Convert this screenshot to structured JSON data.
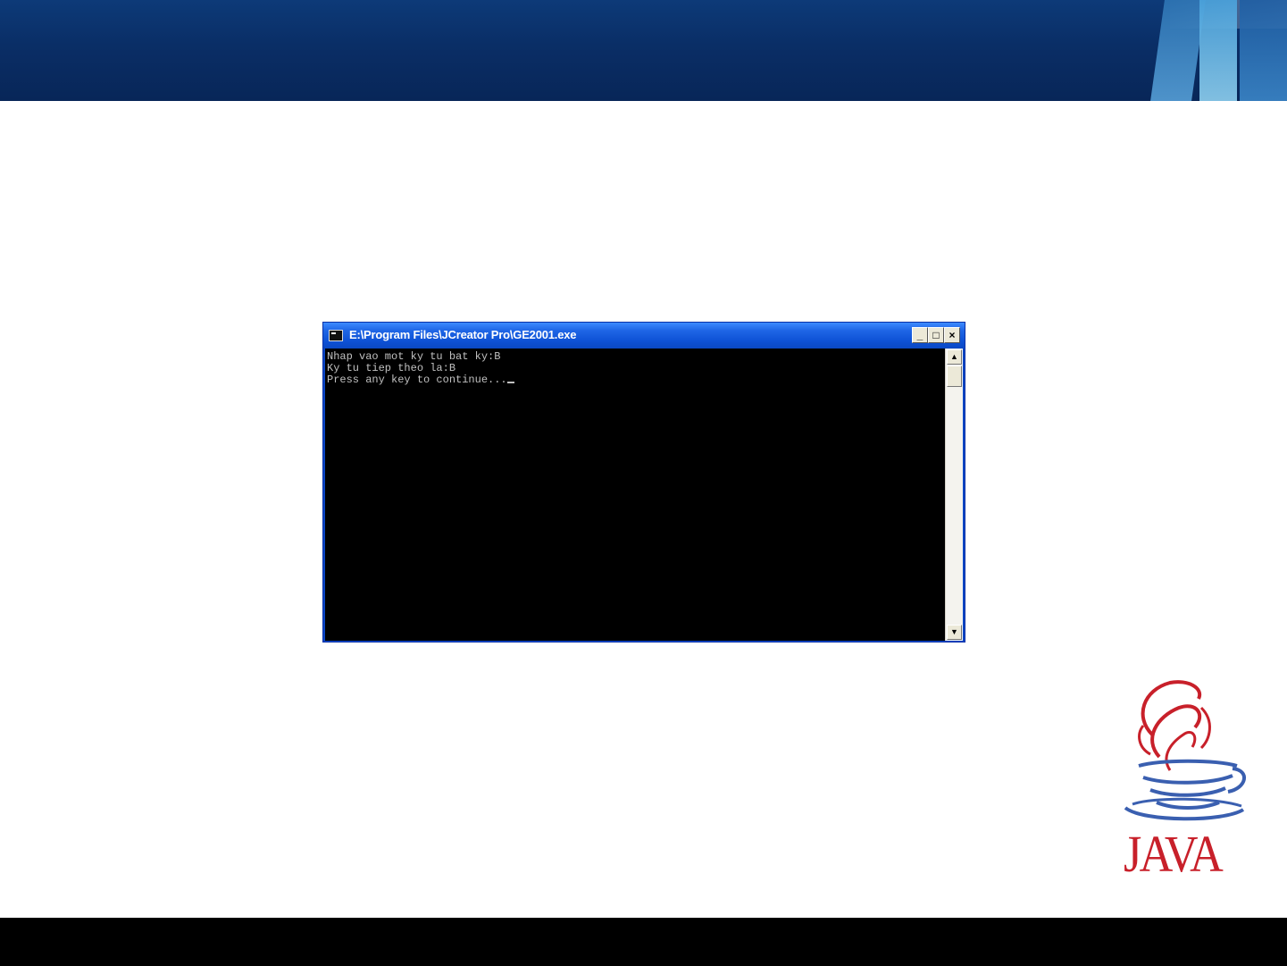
{
  "colors": {
    "header_background": "#0a2e66",
    "titlebar_blue": "#0e52d6",
    "console_background": "#000000",
    "console_text": "#c0c0c0",
    "java_red": "#c8202a",
    "java_blue": "#3a5fb0",
    "footer_background": "#000000"
  },
  "console_window": {
    "title": "E:\\Program Files\\JCreator Pro\\GE2001.exe",
    "buttons": {
      "minimize": "_",
      "maximize": "□",
      "close": "×"
    },
    "output_lines": [
      "Nhap vao mot ky tu bat ky:B",
      "Ky tu tiep theo la:B",
      "Press any key to continue..."
    ],
    "scroll_up_icon": "▲",
    "scroll_down_icon": "▼"
  },
  "logo": {
    "wordmark": "JAVA",
    "icon": "java-coffee-cup-icon"
  }
}
